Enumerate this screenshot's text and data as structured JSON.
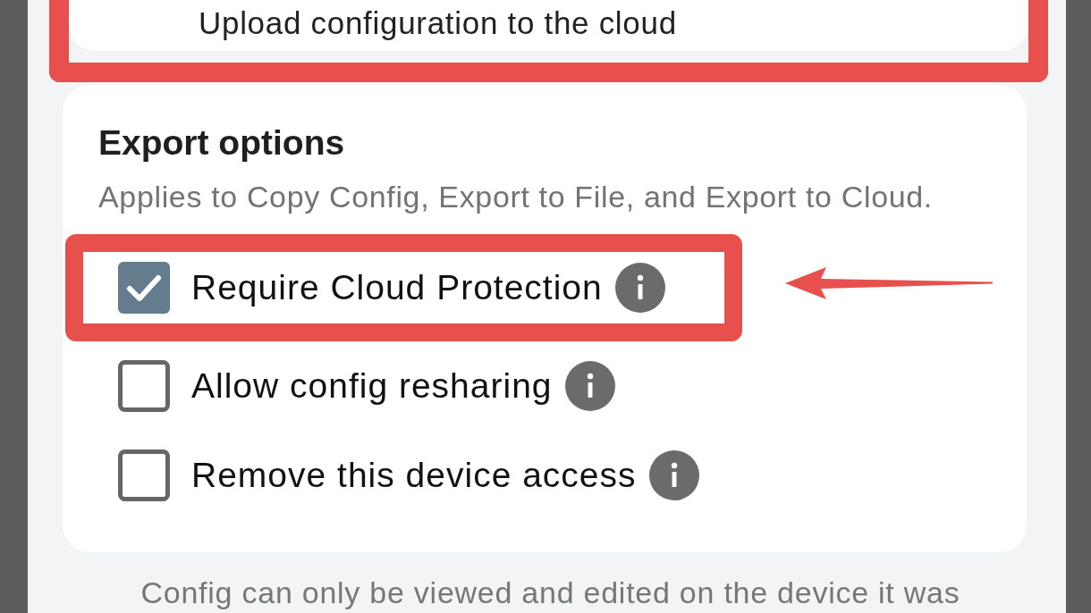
{
  "upload_card": {
    "description": "Upload configuration to the cloud",
    "highlighted": true
  },
  "export_options": {
    "title": "Export options",
    "description": "Applies to Copy Config, Export to File, and Export to Cloud.",
    "options": [
      {
        "label": "Require Cloud Protection",
        "checked": true,
        "highlighted": true
      },
      {
        "label": "Allow config resharing",
        "checked": false,
        "highlighted": false
      },
      {
        "label": "Remove this device access",
        "checked": false,
        "highlighted": false
      }
    ]
  },
  "footer_note": "Config can only be viewed and edited on the device it was"
}
